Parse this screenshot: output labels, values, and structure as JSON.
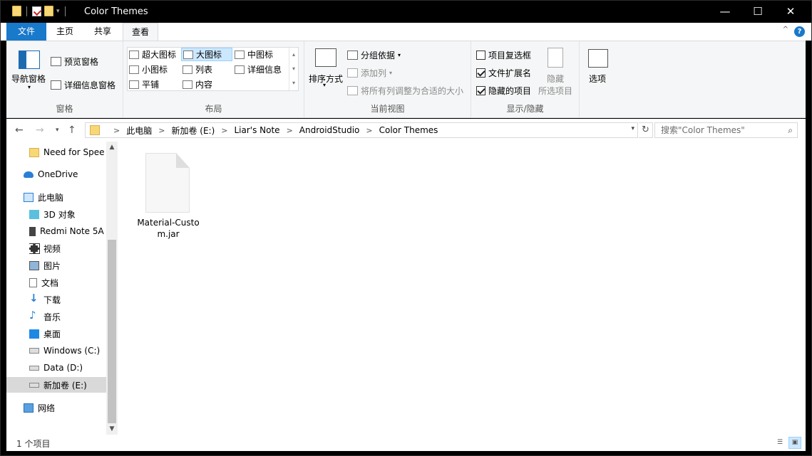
{
  "window": {
    "title": "Color Themes",
    "minimize": "—",
    "maximize": "☐",
    "close": "✕"
  },
  "tabs": {
    "file": "文件",
    "home": "主页",
    "share": "共享",
    "view": "查看"
  },
  "ribbon": {
    "panes": {
      "nav_pane": "导航窗格",
      "preview_pane": "预览窗格",
      "details_pane": "详细信息窗格",
      "label": "窗格"
    },
    "layout": {
      "extra_large": "超大图标",
      "large": "大图标",
      "medium": "中图标",
      "small": "小图标",
      "list": "列表",
      "details": "详细信息",
      "tiles": "平铺",
      "content": "内容",
      "label": "布局"
    },
    "current_view": {
      "sort_by": "排序方式",
      "group_by": "分组依据",
      "add_columns": "添加列",
      "size_columns": "将所有列调整为合适的大小",
      "label": "当前视图"
    },
    "show_hide": {
      "item_checkboxes": "项目复选框",
      "item_checkboxes_checked": false,
      "file_extensions": "文件扩展名",
      "file_extensions_checked": true,
      "hidden_items": "隐藏的项目",
      "hidden_items_checked": true,
      "hide_selected_1": "隐藏",
      "hide_selected_2": "所选项目",
      "label": "显示/隐藏"
    },
    "options": "选项"
  },
  "address": {
    "crumbs": [
      "此电脑",
      "新加卷 (E:)",
      "Liar's Note",
      "AndroidStudio",
      "Color Themes"
    ],
    "search_placeholder": "搜索\"Color Themes\""
  },
  "nav_pane": {
    "items": [
      {
        "label": "Need for Spee",
        "icon": "folder-icon"
      },
      {
        "label": "OneDrive",
        "icon": "onedrive-icon"
      },
      {
        "label": "此电脑",
        "icon": "computer-icon"
      },
      {
        "label": "3D 对象",
        "icon": "3d-objects-icon"
      },
      {
        "label": "Redmi Note 5A",
        "icon": "phone-icon"
      },
      {
        "label": "视频",
        "icon": "video-icon"
      },
      {
        "label": "图片",
        "icon": "pictures-icon"
      },
      {
        "label": "文档",
        "icon": "documents-icon"
      },
      {
        "label": "下载",
        "icon": "download-icon"
      },
      {
        "label": "音乐",
        "icon": "music-icon"
      },
      {
        "label": "桌面",
        "icon": "desktop-icon"
      },
      {
        "label": "Windows (C:)",
        "icon": "windows-drive-icon"
      },
      {
        "label": "Data (D:)",
        "icon": "drive-icon"
      },
      {
        "label": "新加卷 (E:)",
        "icon": "drive-icon"
      },
      {
        "label": "网络",
        "icon": "network-icon"
      }
    ]
  },
  "files": [
    {
      "name": "Material-Custom.jar",
      "icon": "jar-file-icon"
    }
  ],
  "status": {
    "count": "1 个项目"
  },
  "colors": {
    "accent": "#1979ca",
    "selection": "#cce8ff",
    "folder": "#f8d775"
  }
}
